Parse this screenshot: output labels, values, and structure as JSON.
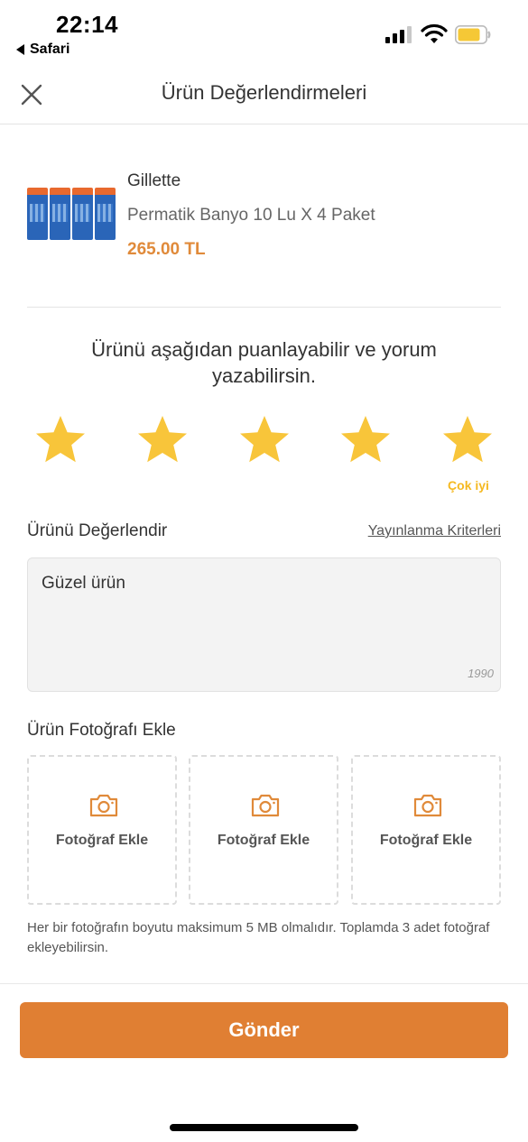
{
  "status_bar": {
    "time": "22:14",
    "back_app": "Safari",
    "signal_icon": "cellular-signal-icon",
    "wifi_icon": "wifi-icon",
    "battery_icon": "battery-icon",
    "battery_color": "#f5c836"
  },
  "header": {
    "title": "Ürün Değerlendirmeleri",
    "close_icon": "close-icon"
  },
  "product": {
    "brand": "Gillette",
    "name": "Permatik Banyo 10 Lu X 4 Paket",
    "price": "265.00 TL"
  },
  "rating": {
    "prompt": "Ürünü aşağıdan puanlayabilir ve yorum yazabilirsin.",
    "value": 5,
    "max": 5,
    "label": "Çok iyi",
    "star_color": "#f8c53a"
  },
  "review": {
    "section_title": "Ürünü Değerlendir",
    "criteria_link": "Yayınlanma Kriterleri",
    "text": "Güzel ürün",
    "remaining_chars": "1990"
  },
  "photos": {
    "section_title": "Ürün Fotoğrafı Ekle",
    "slots": [
      {
        "label": "Fotoğraf Ekle",
        "icon": "camera-icon"
      },
      {
        "label": "Fotoğraf Ekle",
        "icon": "camera-icon"
      },
      {
        "label": "Fotoğraf Ekle",
        "icon": "camera-icon"
      }
    ],
    "note": "Her bir fotoğrafın boyutu maksimum 5 MB olmalıdır. Toplamda 3 adet fotoğraf ekleyebilirsin."
  },
  "submit": {
    "label": "Gönder",
    "color": "#e07f33"
  },
  "accent_color": "#e08a3a"
}
